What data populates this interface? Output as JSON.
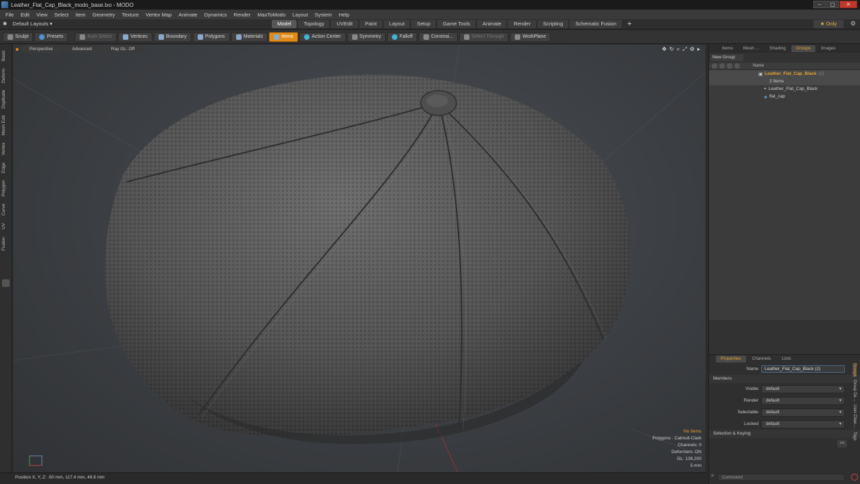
{
  "window": {
    "title": "Leather_Flat_Cap_Black_modo_base.lxo - MODO",
    "controls": [
      "–",
      "▢",
      "✕"
    ]
  },
  "menu": [
    "File",
    "Edit",
    "View",
    "Select",
    "Item",
    "Geometry",
    "Texture",
    "Vertex Map",
    "Animate",
    "Dynamics",
    "Render",
    "MaxToModo",
    "Layout",
    "System",
    "Help"
  ],
  "layouts": {
    "label": "Default Layouts ▾"
  },
  "tabs": [
    "Model",
    "Topology",
    "UVEdit",
    "Paint",
    "Layout",
    "Setup",
    "Game Tools",
    "Animate",
    "Render",
    "Scripting",
    "Schematic Fusion"
  ],
  "active_tab": "Model",
  "only_label": "★  Only",
  "toolbar": {
    "sculpt": "Sculpt",
    "presets": "Presets",
    "auto_select": "Auto Select",
    "vertices": "Vertices",
    "boundary": "Boundary",
    "polygons": "Polygons",
    "materials": "Materials",
    "items": "Items",
    "action_center": "Action Center",
    "symmetry": "Symmetry",
    "falloff": "Falloff",
    "constraints": "Constrai...",
    "select_through": "Select Through",
    "workplane": "WorkPlane"
  },
  "left_tabs": [
    "Basic",
    "Deform",
    "Duplicate",
    "Mesh Edit",
    "Vertex",
    "Edge",
    "Polygon",
    "Curve",
    "UV",
    "Fusion"
  ],
  "viewport": {
    "view_label": "Perspective",
    "advanced_label": "Advanced",
    "raygl_label": "Ray GL: Off",
    "info": {
      "no_items": "No Items",
      "polygons": "Polygons : Catmull-Clark",
      "channels": "Channels: 0",
      "deformers": "Deformers: ON",
      "gl": "GL: 139,200",
      "scale": "5 mm"
    }
  },
  "status": {
    "position": "Position X, Y, Z:  -50 mm, 117.4 mm, 49.8 mm"
  },
  "right_panel": {
    "tabs": [
      "Items",
      "Mesh ...",
      "Shading",
      "Groups",
      "Images"
    ],
    "active_tab": "Groups",
    "new_group": "New Group",
    "tree_header_name": "Name",
    "group_name": "Leather_Flat_Cap_Black",
    "group_count": "(2)",
    "group_items": "2 Items",
    "children": [
      "Leather_Flat_Cap_Black",
      "flat_cap"
    ]
  },
  "properties": {
    "tabs": [
      "Properties",
      "Channels",
      "Lists"
    ],
    "active_tab": "Properties",
    "name_label": "Name",
    "name_value": "Leather_Flat_Cap_Black (2)",
    "members_label": "Members",
    "fields": [
      {
        "label": "Visible",
        "value": "default"
      },
      {
        "label": "Render",
        "value": "default"
      },
      {
        "label": "Selectable",
        "value": "default"
      },
      {
        "label": "Locked",
        "value": "default"
      }
    ],
    "selection_keying": "Selection & Keying",
    "expand": ">>",
    "side_tabs": [
      "Groups",
      "Group De ...",
      "User Chan ...",
      "Tags"
    ],
    "command_placeholder": "Command"
  }
}
